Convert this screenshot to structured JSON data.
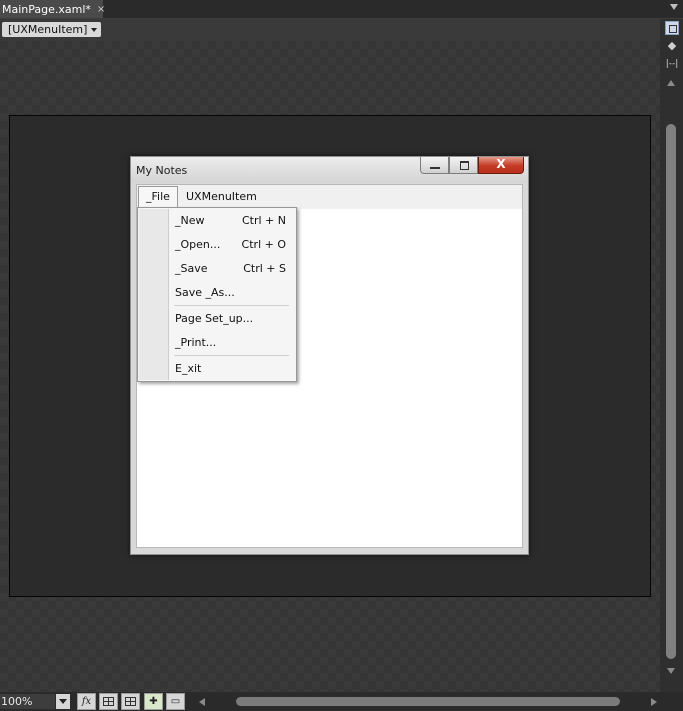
{
  "tab": {
    "title": "MainPage.xaml*",
    "close_glyph": "×"
  },
  "breadcrumb": {
    "label": "[UXMenuItem]"
  },
  "right_toolbar": {
    "icons": [
      "pan-icon",
      "arrows-icon",
      "ruler-icon"
    ],
    "arrows_glyph": "◆",
    "ruler_glyph": "|--|"
  },
  "window": {
    "title": "My Notes",
    "close_glyph": "X",
    "menu": [
      {
        "label": "_File"
      },
      {
        "label": "UXMenuItem"
      }
    ],
    "file_menu": {
      "items": [
        {
          "label": "_New",
          "shortcut": "Ctrl + N"
        },
        {
          "label": "_Open...",
          "shortcut": "Ctrl + O"
        },
        {
          "label": "_Save",
          "shortcut": "Ctrl + S"
        },
        {
          "label": "Save _As...",
          "shortcut": ""
        },
        {
          "label": "Page Set_up...",
          "shortcut": ""
        },
        {
          "label": "_Print...",
          "shortcut": ""
        },
        {
          "label": "E_xit",
          "shortcut": ""
        }
      ]
    }
  },
  "statusbar": {
    "zoom": "100%",
    "fx_glyph": "fx",
    "snap_glyph": "✚",
    "note_glyph": "▭"
  },
  "colors": {
    "canvas_bg": "#353535",
    "close_button": "#c53a24",
    "window_chrome": "#d8d8d8"
  }
}
